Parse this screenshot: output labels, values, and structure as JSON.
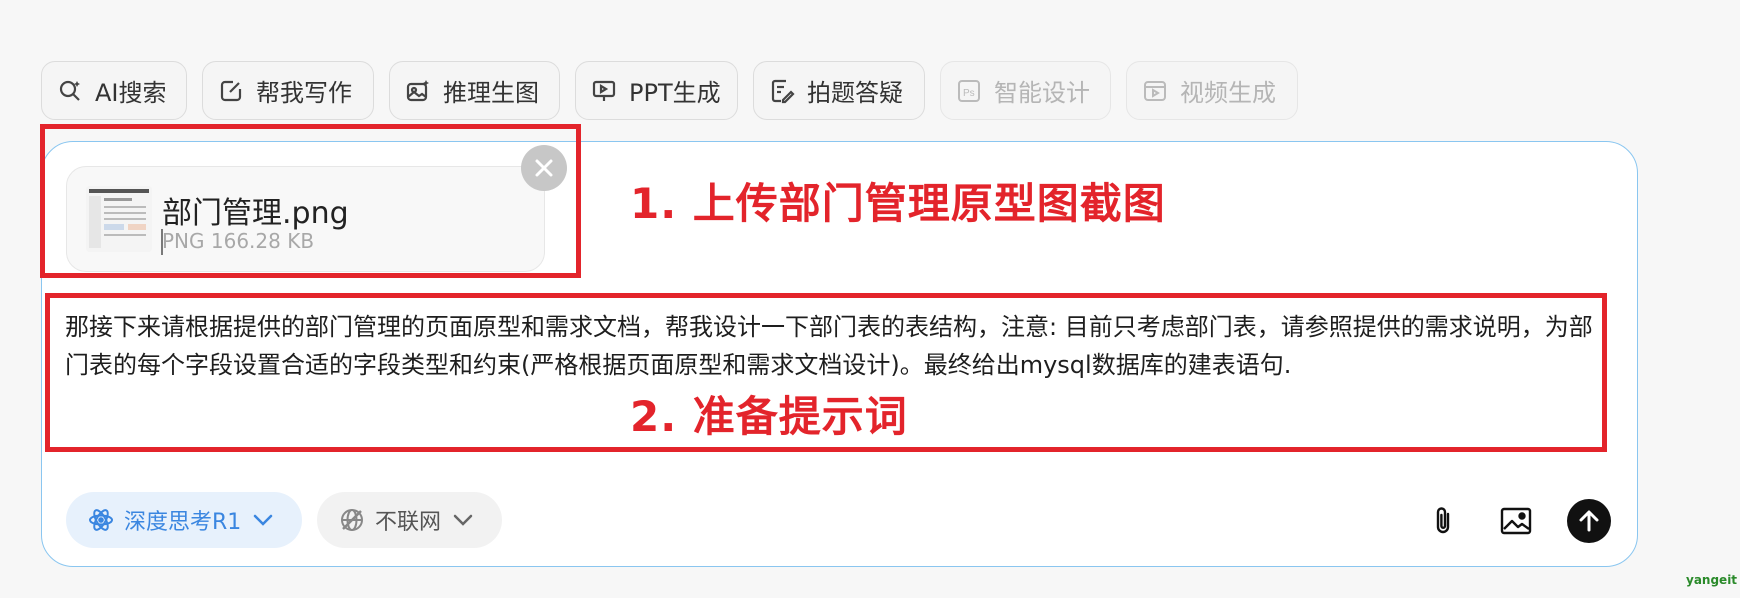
{
  "toolbar": {
    "items": [
      {
        "label": "AI搜索",
        "icon": "ai-search-icon",
        "enabled": true
      },
      {
        "label": "帮我写作",
        "icon": "edit-icon",
        "enabled": true
      },
      {
        "label": "推理生图",
        "icon": "image-gen-icon",
        "enabled": true
      },
      {
        "label": "PPT生成",
        "icon": "presentation-icon",
        "enabled": true
      },
      {
        "label": "拍题答疑",
        "icon": "question-photo-icon",
        "enabled": true
      },
      {
        "label": "智能设计",
        "icon": "ps-design-icon",
        "enabled": false
      },
      {
        "label": "视频生成",
        "icon": "video-icon",
        "enabled": false
      }
    ]
  },
  "attachment": {
    "file_name": "部门管理.png",
    "file_meta": "PNG 166.28 KB"
  },
  "annotations": {
    "step1": "1. 上传部门管理原型图截图",
    "step2": "2. 准备提示词"
  },
  "prompt": {
    "text": "那接下来请根据提供的部门管理的页面原型和需求文档，帮我设计一下部门表的表结构，注意: 目前只考虑部门表，请参照提供的需求说明，为部门表的每个字段设置合适的字段类型和约束(严格根据页面原型和需求文档设计)。最终给出mysql数据库的建表语句."
  },
  "controls": {
    "deep_think_label": "深度思考R1",
    "network_label": "不联网"
  },
  "colors": {
    "accent_blue": "#3a86e0",
    "annotation_red": "#e3242b",
    "composer_border": "#8ac6f0"
  },
  "watermark": "yangeit"
}
